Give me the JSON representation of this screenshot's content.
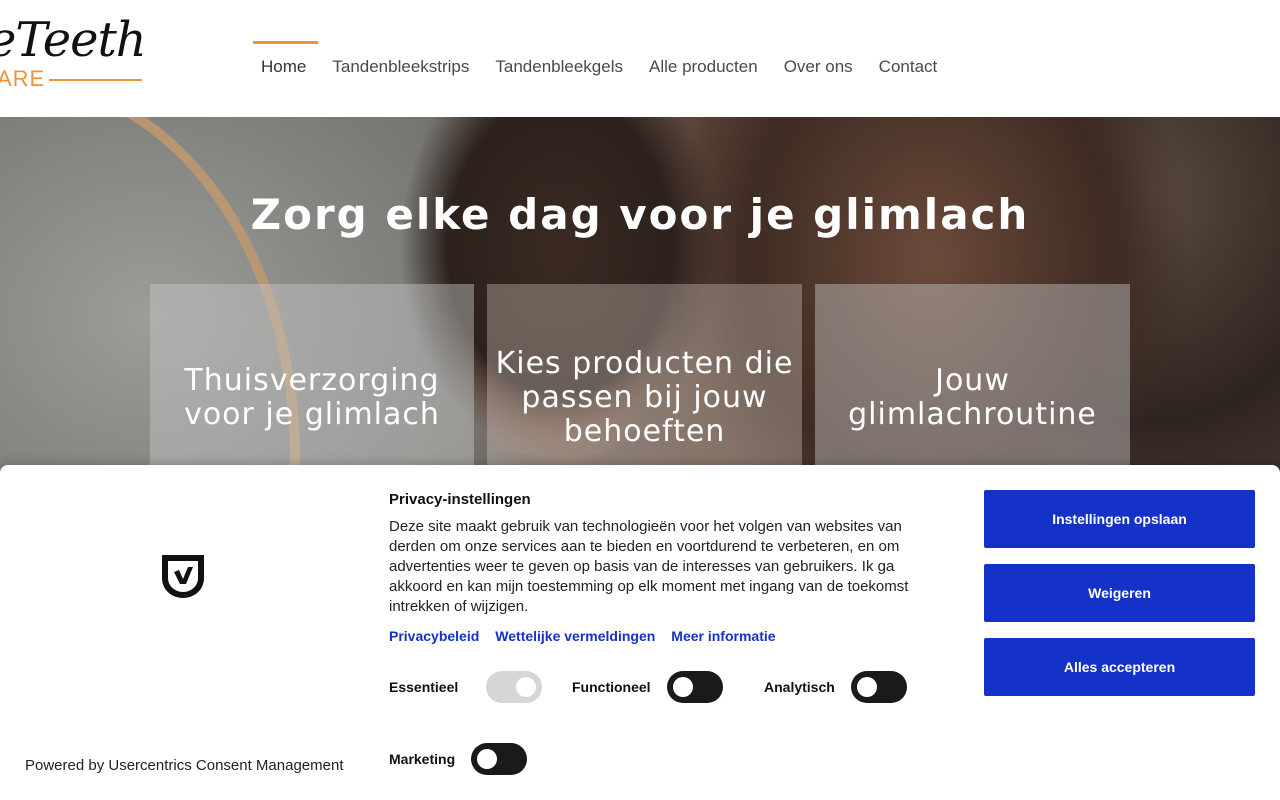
{
  "logo": {
    "script": "eTeeth",
    "sub": "ARE"
  },
  "nav": {
    "items": [
      {
        "label": "Home"
      },
      {
        "label": "Tandenbleekstrips"
      },
      {
        "label": "Tandenbleekgels"
      },
      {
        "label": "Alle producten"
      },
      {
        "label": "Over ons"
      },
      {
        "label": "Contact"
      }
    ]
  },
  "hero": {
    "title": "Zorg elke dag voor je glimlach",
    "cards": [
      {
        "label": "Thuisverzorging voor je glimlach"
      },
      {
        "label": "Kies producten die passen bij jouw behoeften"
      },
      {
        "label": "Jouw glimlachroutine"
      }
    ]
  },
  "consent": {
    "title": "Privacy-instellingen",
    "text": "Deze site maakt gebruik van technologieën voor het volgen van websites van derden om onze services aan te bieden en voortdurend te verbeteren, en om advertenties weer te geven op basis van de interesses van gebruikers. Ik ga akkoord en kan mijn toestemming op elk moment met ingang van de toekomst intrekken of wijzigen.",
    "links": {
      "privacy": "Privacybeleid",
      "legal": "Wettelijke vermeldingen",
      "more": "Meer informatie"
    },
    "toggles": {
      "essential": {
        "label": "Essentieel",
        "state": "on"
      },
      "functional": {
        "label": "Functioneel",
        "state": "off"
      },
      "analytics": {
        "label": "Analytisch",
        "state": "off"
      },
      "marketing": {
        "label": "Marketing",
        "state": "off"
      }
    },
    "buttons": {
      "save": "Instellingen opslaan",
      "reject": "Weigeren",
      "accept": "Alles accepteren"
    },
    "powered": "Powered by Usercentrics Consent Management"
  },
  "colors": {
    "accent": "#f2923a",
    "consent_blue": "#1432c8"
  }
}
